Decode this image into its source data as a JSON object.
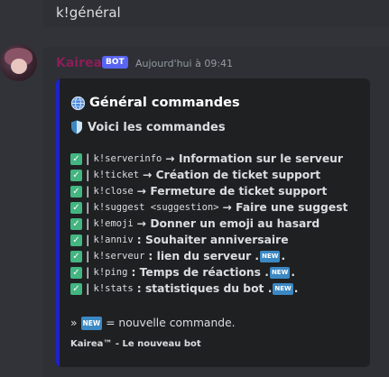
{
  "previous_message": {
    "text": "k!général"
  },
  "message": {
    "username": "Kairea",
    "bot_badge": "BOT",
    "timestamp": "Aujourd'hui à 09:41"
  },
  "embed": {
    "accent_color": "#1e22c9",
    "title_icon": "globe-icon",
    "title": "Général commandes",
    "subtitle_icon": "shield-icon",
    "subtitle": "Voici les commandes",
    "commands": [
      {
        "cmd": "k!serverinfo",
        "desc": "→ Information sur le serveur",
        "new": false
      },
      {
        "cmd": "k!ticket",
        "desc": "→ Création de ticket support",
        "new": false
      },
      {
        "cmd": "k!close",
        "desc": "→ Fermeture de ticket support",
        "new": false
      },
      {
        "cmd": "k!suggest <suggestion>",
        "desc": "→ Faire une suggest",
        "new": false
      },
      {
        "cmd": "k!emoji",
        "desc": "→ Donner un emoji au hasard",
        "new": false
      },
      {
        "cmd": "k!anniv",
        "desc": ": Souhaiter anniversaire",
        "new": false
      },
      {
        "cmd": "k!serveur",
        "desc": ": lien du serveur .",
        "new": true
      },
      {
        "cmd": "k!ping",
        "desc": ": Temps de réactions .",
        "new": true
      },
      {
        "cmd": "k!stats",
        "desc": ": statistiques du bot .",
        "new": true
      }
    ],
    "check_glyph": "✓",
    "new_badge_text": "NEW",
    "legend_prefix": "»",
    "legend_text": "= nouvelle commande.",
    "footer": "Kairea™ - Le nouveau bot"
  }
}
